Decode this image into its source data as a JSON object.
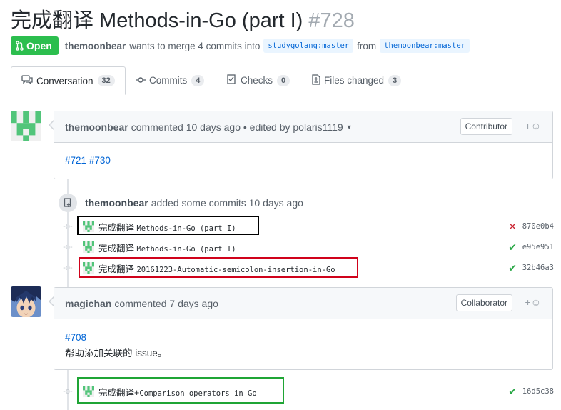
{
  "pr": {
    "title": "完成翻译 Methods-in-Go (part I)",
    "number": "#728",
    "state": "Open",
    "author": "themoonbear",
    "merge_text": "wants to merge 4 commits into",
    "base_branch": "studygolang:master",
    "from_text": "from",
    "head_branch": "themoonbear:master"
  },
  "tabs": [
    {
      "label": "Conversation",
      "count": "32",
      "icon": "comment-discussion-icon"
    },
    {
      "label": "Commits",
      "count": "4",
      "icon": "git-commit-icon"
    },
    {
      "label": "Checks",
      "count": "0",
      "icon": "checklist-icon"
    },
    {
      "label": "Files changed",
      "count": "3",
      "icon": "file-diff-icon"
    }
  ],
  "comment1": {
    "author": "themoonbear",
    "meta": "commented 10 days ago • edited by polaris1119",
    "role": "Contributor",
    "body_links": [
      "#721",
      "#730"
    ]
  },
  "event1": {
    "author": "themoonbear",
    "text": "added some commits 10 days ago"
  },
  "commits_a": [
    {
      "prefix": "完成翻译 ",
      "code": "Methods-in-Go (part I)",
      "status": "fail",
      "status_glyph": "✕",
      "sha": "870e0b4"
    },
    {
      "prefix": "完成翻译 ",
      "code": "Methods-in-Go (part I)",
      "status": "ok",
      "status_glyph": "✔",
      "sha": "e95e951"
    },
    {
      "prefix": "完成翻译 ",
      "code": "20161223-Automatic-semicolon-insertion-in-Go",
      "status": "ok",
      "status_glyph": "✔",
      "sha": "32b46a3"
    }
  ],
  "comment2": {
    "author": "magichan",
    "meta": "commented 7 days ago",
    "role": "Collaborator",
    "link": "#708",
    "text": "帮助添加关联的 issue。"
  },
  "commits_b": [
    {
      "prefix": "完成翻译+",
      "code": "Comparison operators in Go",
      "status": "ok",
      "status_glyph": "✔",
      "sha": "16d5c38"
    }
  ],
  "colors": {
    "open_green": "#2cbe4e",
    "link_blue": "#0366d6",
    "highlight_black": "#000000",
    "highlight_red": "#d0021b",
    "highlight_green": "#1fa535"
  }
}
